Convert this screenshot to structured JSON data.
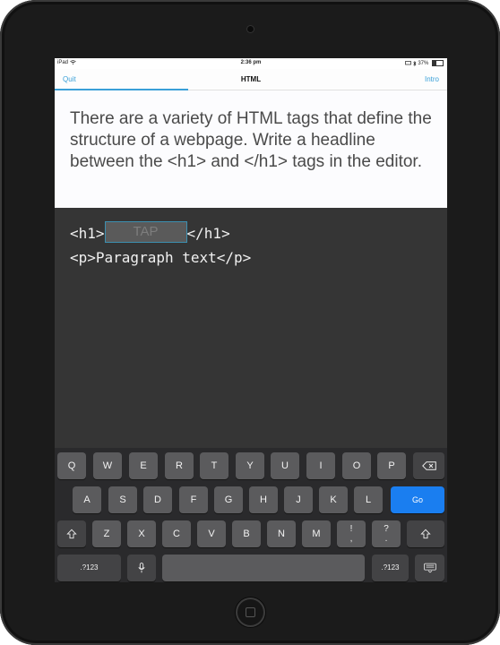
{
  "status_bar": {
    "device": "iPad",
    "time": "2:36 pm",
    "battery": "37%"
  },
  "nav": {
    "quit_label": "Quit",
    "title": "HTML",
    "intro_label": "Intro",
    "progress_fraction": 0.34
  },
  "instruction": {
    "text": "There are a variety of HTML tags that define the structure of a webpage. Write a headline between the <h1> and </h1> tags in the editor."
  },
  "editor": {
    "line1_open": "<h1>",
    "tap_placeholder": "TAP",
    "line1_close": "</h1>",
    "line2": "<p>Paragraph text</p>"
  },
  "keyboard": {
    "row1": [
      "Q",
      "W",
      "E",
      "R",
      "T",
      "Y",
      "U",
      "I",
      "O",
      "P"
    ],
    "row2": [
      "A",
      "S",
      "D",
      "F",
      "G",
      "H",
      "J",
      "K",
      "L"
    ],
    "go_label": "Go",
    "row3": [
      "Z",
      "X",
      "C",
      "V",
      "B",
      "N",
      "M"
    ],
    "exclaim_top": "!",
    "exclaim_bottom": ",",
    "question_top": "?",
    "question_bottom": ".",
    "numbers_label": ".?123",
    "numbers_label_right": ".?123",
    "accent_color": "#1a7ef0"
  }
}
